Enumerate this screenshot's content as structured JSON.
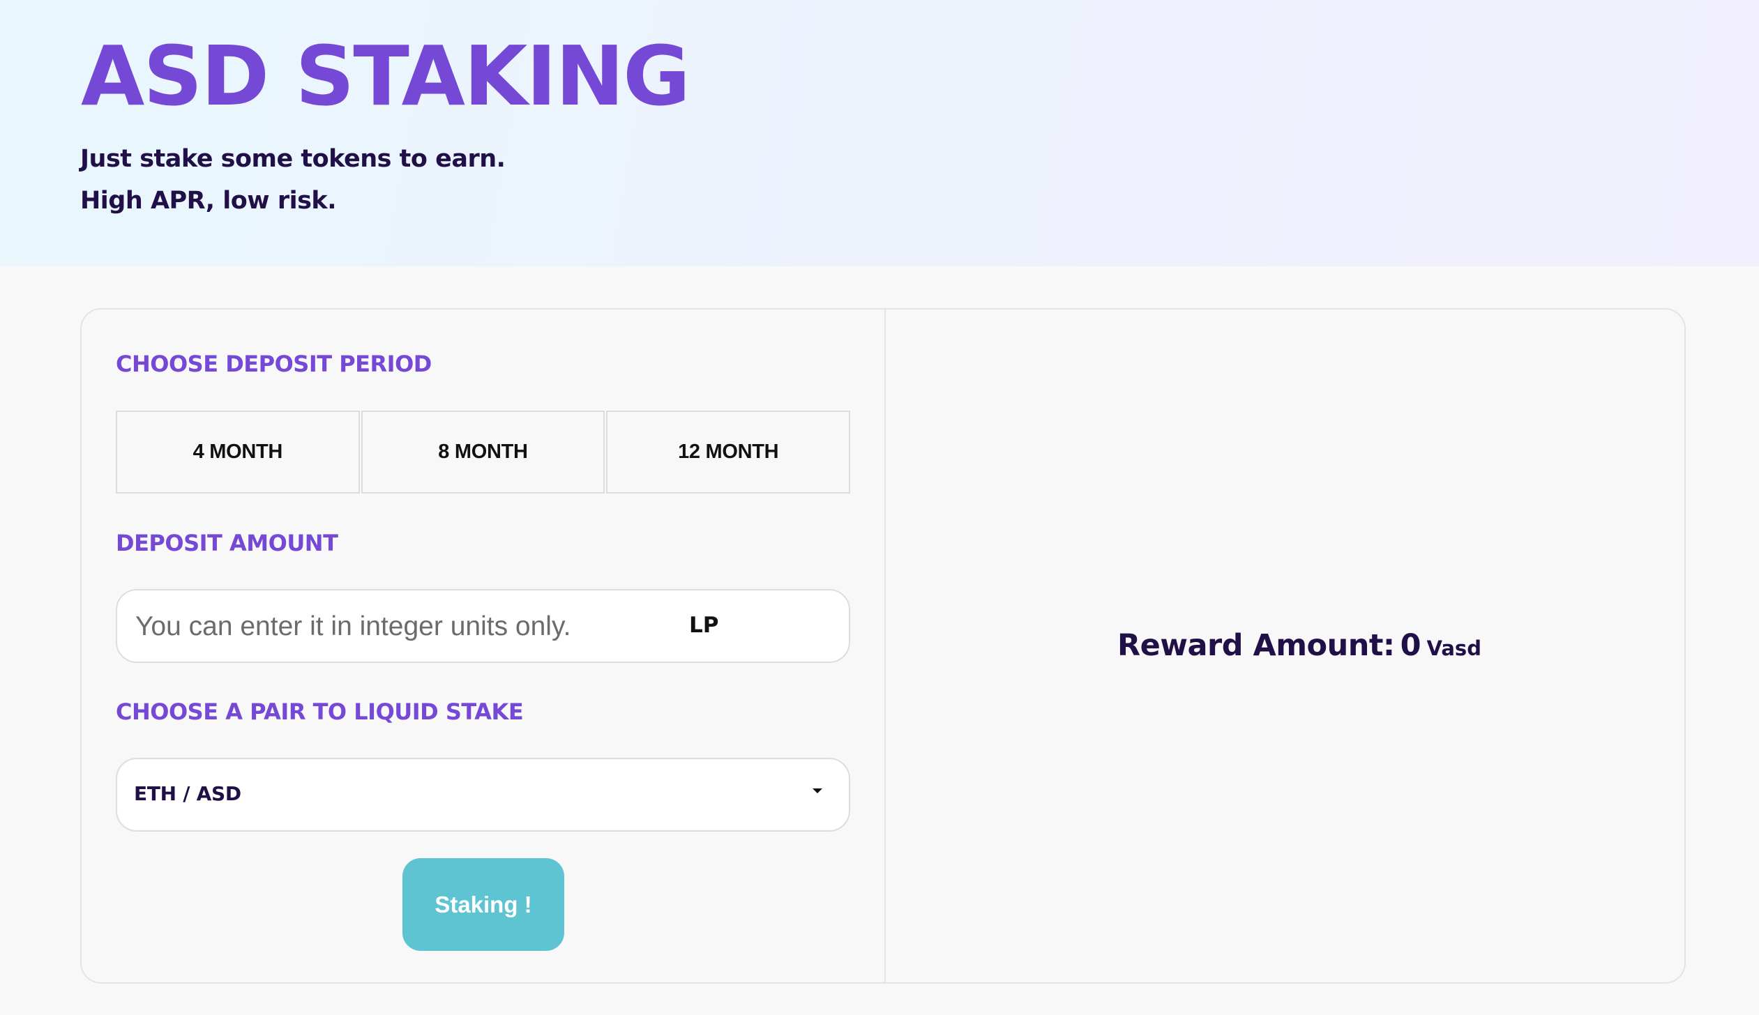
{
  "hero": {
    "title": "ASD STAKING",
    "tagline_1": "Just stake some tokens to earn.",
    "tagline_2": "High APR, low risk."
  },
  "deposit_period": {
    "label": "CHOOSE DEPOSIT PERIOD",
    "options": [
      "4 MONTH",
      "8 MONTH",
      "12 MONTH"
    ]
  },
  "deposit_amount": {
    "label": "DEPOSIT AMOUNT",
    "placeholder": "You can enter it in integer units only.",
    "value": "",
    "unit": "LP"
  },
  "pair": {
    "label": "CHOOSE A PAIR TO LIQUID STAKE",
    "selected": "ETH / ASD"
  },
  "stake_button": {
    "label": "Staking !"
  },
  "reward": {
    "label": "Reward Amount:",
    "value": "0",
    "unit": "Vasd"
  },
  "colors": {
    "accent": "#7548d6",
    "dark_text": "#211047",
    "button": "#5fc4d2"
  }
}
